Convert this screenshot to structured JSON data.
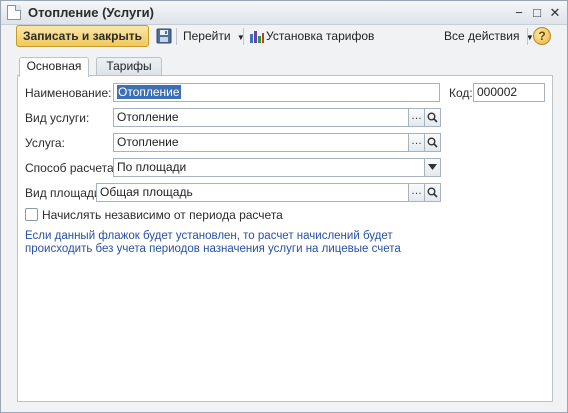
{
  "window": {
    "title": "Отопление (Услуги)",
    "controls": {
      "minimize": "−",
      "maximize": "□",
      "close": "✕"
    }
  },
  "toolbar": {
    "save_close_label": "Записать и закрыть",
    "save_icon": "floppy-disk-icon",
    "goto_label": "Перейти",
    "tariff_label": "Установка тарифов",
    "tariff_icon": "bar-chart-icon",
    "all_actions_label": "Все действия",
    "help_label": "?"
  },
  "tabs": [
    {
      "label": "Основная",
      "active": true
    },
    {
      "label": "Тарифы",
      "active": false
    }
  ],
  "form": {
    "name": {
      "label": "Наименование:",
      "value": "Отопление"
    },
    "code": {
      "label": "Код:",
      "value": "000002"
    },
    "service_type": {
      "label": "Вид услуги:",
      "value": "Отопление"
    },
    "service": {
      "label": "Услуга:",
      "value": "Отопление"
    },
    "calc_method": {
      "label": "Способ расчета:",
      "value": "По площади"
    },
    "area_type": {
      "label": "Вид площади:",
      "value": "Общая площадь"
    },
    "independent": {
      "label": "Начислять независимо от периода расчета",
      "checked": false
    },
    "hint": "Если данный флажок будет установлен, то расчет начислений будет происходить без учета периодов назначения услуги на лицевые счета"
  },
  "colors": {
    "accent_button": "#f0c95c",
    "selection": "#3d6fb6",
    "hint_text": "#2750a6"
  }
}
